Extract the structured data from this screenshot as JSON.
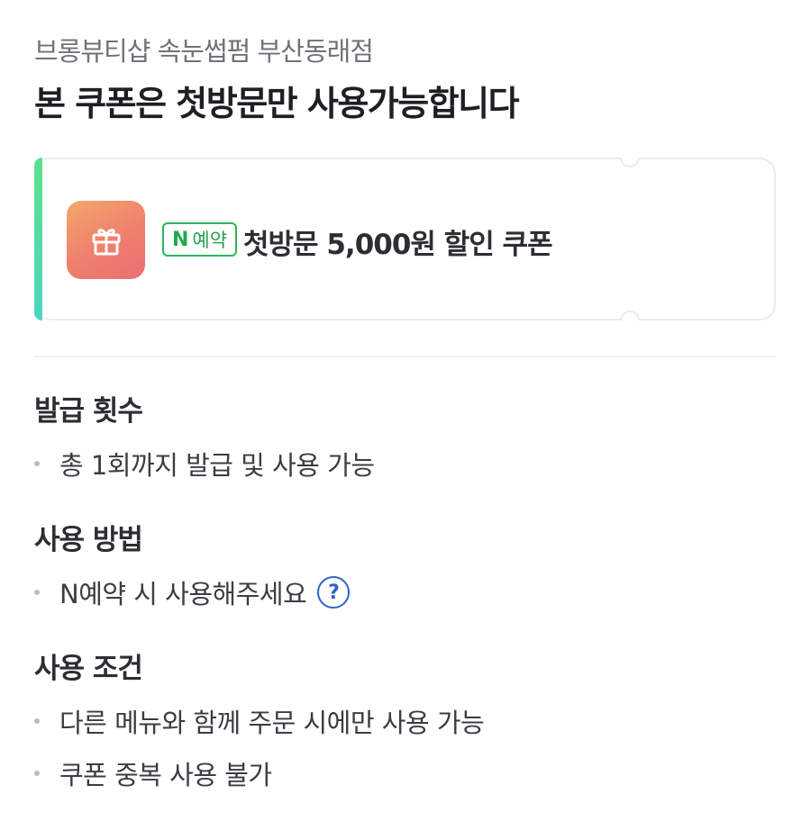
{
  "header": {
    "store_name": "브롱뷰티샵 속눈썹펌 부산동래점",
    "headline": "본 쿠폰은 첫방문만 사용가능합니다"
  },
  "coupon": {
    "badge_n": "N",
    "badge_text": "예약",
    "title": "첫방문 5,000원 할인 쿠폰",
    "icon": "gift-icon",
    "accent_colors": [
      "#5fe08c",
      "#4fd4c0"
    ],
    "tile_colors": [
      "#f2a86b",
      "#ea6f72"
    ]
  },
  "sections": {
    "issue_count": {
      "title": "발급 횟수",
      "items": [
        "총 1회까지 발급 및 사용 가능"
      ]
    },
    "usage_method": {
      "title": "사용 방법",
      "items": [
        "N예약 시 사용해주세요"
      ],
      "help_icon": "question-circle-icon",
      "help_glyph": "?"
    },
    "usage_conditions": {
      "title": "사용 조건",
      "items": [
        "다른 메뉴와 함께 주문 시에만 사용 가능",
        "쿠폰 중복 사용 불가"
      ]
    }
  }
}
